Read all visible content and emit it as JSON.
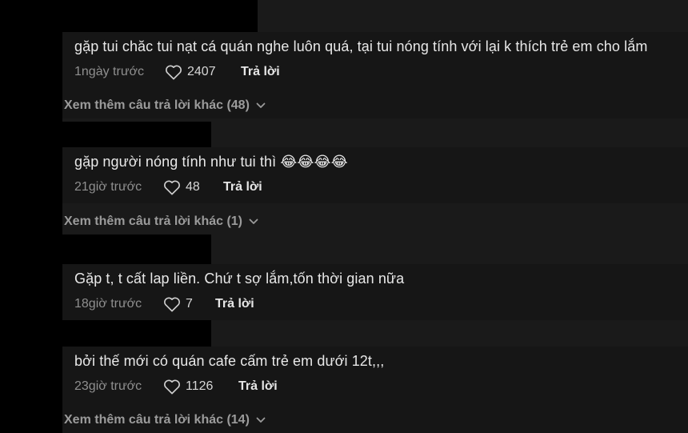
{
  "comments": [
    {
      "text": "gặp tui chăc tui nạt cá quán nghe luôn quá, tại tui nóng tính với lại k thích trẻ em cho lắm",
      "time": "1ngày trước",
      "likes": "2407",
      "reply_label": "Trả lời",
      "more_replies": "Xem thêm câu trả lời khác (48)"
    },
    {
      "text": "gặp người nóng tính như tui thì 😂😂😂😂",
      "time": "21giờ trước",
      "likes": "48",
      "reply_label": "Trả lời",
      "more_replies": "Xem thêm câu trả lời khác (1)"
    },
    {
      "text": "Gặp t, t cất lap liền. Chứ t sợ lắm,tốn thời gian nữa",
      "time": "18giờ trước",
      "likes": "7",
      "reply_label": "Trả lời"
    },
    {
      "text": "bởi thế mới có quán cafe cấm trẻ em dưới 12t,,,",
      "time": "23giờ trước",
      "likes": "1126",
      "reply_label": "Trả lời",
      "more_replies": "Xem thêm câu trả lời khác (14)"
    }
  ],
  "icons": {
    "like": "heart-outline-icon",
    "expand": "chevron-down-icon"
  },
  "colors": {
    "background": "#1a1a1a",
    "redaction": "#000000",
    "muted_text": "#8f8f8f",
    "primary_text": "#e8e8e8"
  }
}
